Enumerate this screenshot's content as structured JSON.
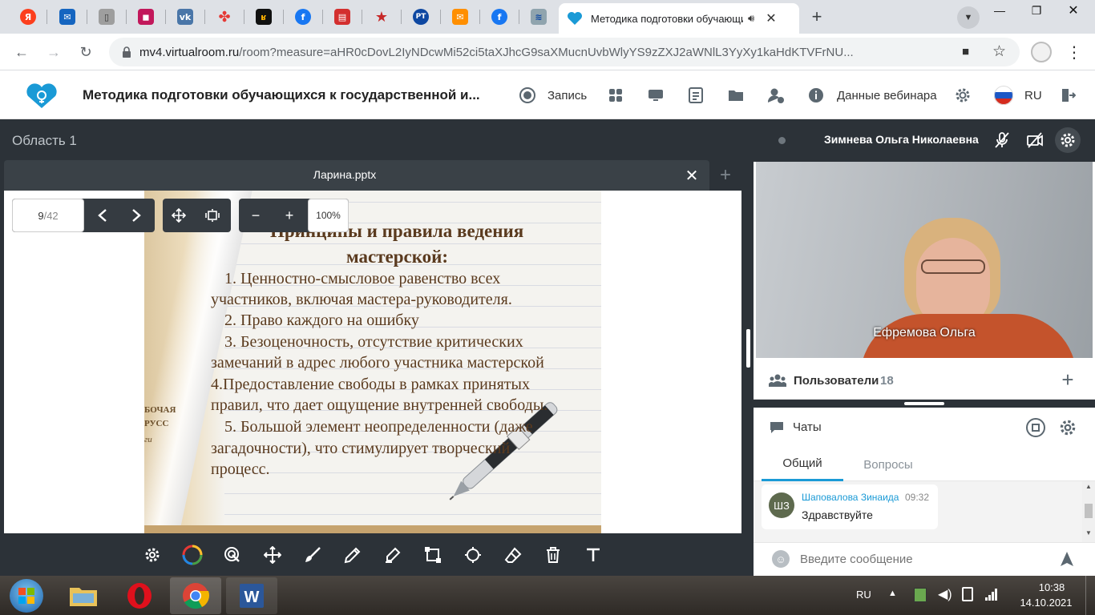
{
  "browser": {
    "active_tab_title": "Методика подготовки обучающихся к государственной итоговой аттестации",
    "url_domain": "mv4.virtualroom.ru",
    "url_path": "/room?measure=aHR0cDovL2IyNDcwMi52ci5taXJhcG9saXMucnUvbWlyYS9zZXJ2aWNlL3YyXy1kaHdKTVFrNU..."
  },
  "header": {
    "title": "Методика подготовки обучающихся к государственной и...",
    "record_label": "Запись",
    "webinar_data_label": "Данные вебинара",
    "language": "RU"
  },
  "workspace": {
    "area_label": "Область 1",
    "file_name": "Ларина.pptx",
    "page_current": "9",
    "page_total": "/42",
    "zoom": "100%"
  },
  "slide": {
    "title_line1": "Принципы и правила ведения",
    "title_line2": "мастерской:",
    "lines": [
      "1. Ценностно-смысловое равенство всех",
      "участников, включая мастера-руководителя.",
      "2.  Право каждого на ошибку",
      "3. Безоценочность, отсутствие критических",
      "замечаний в адрес любого участника мастерской",
      "4.Предоставление свободы в рамках принятых",
      "правил, что дает ощущение внутренней свободы.",
      "5. Большой элемент неопределенности (даже",
      "загадочности), что стимулирует творческий",
      "процесс."
    ],
    "book_text_1": "БОЧАЯ",
    "book_text_2": "РУСС",
    "book_text_3": "ги"
  },
  "speaker": {
    "presenter_name": "Зимнева Ольга Николаевна",
    "video_name": "Ефремова Ольга"
  },
  "users": {
    "label": "Пользователи",
    "count": "18"
  },
  "chats": {
    "label": "Чаты",
    "tab_general": "Общий",
    "tab_questions": "Вопросы",
    "message": {
      "avatar": "ШЗ",
      "author": "Шаповалова Зинаида",
      "time": "09:32",
      "text": "Здравствуйте"
    },
    "input_placeholder": "Введите сообщение"
  },
  "taskbar": {
    "lang": "RU",
    "time": "10:38",
    "date": "14.10.2021"
  },
  "colors": {
    "accent": "#1a9ad6",
    "dark_panel": "#2c3238",
    "avatar_bg": "#5e6a4e"
  }
}
